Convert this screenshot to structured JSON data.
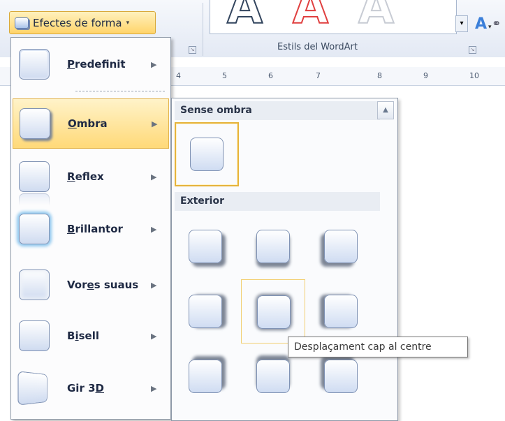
{
  "ribbon": {
    "wordart_group_label": "Estils del WordArt",
    "wordart_letter": "A",
    "text_fill_letter": "A"
  },
  "ruler": {
    "labels": [
      "4",
      "5",
      "6",
      "7",
      "8",
      "9",
      "10"
    ]
  },
  "shape_effects_button": {
    "label": "Efectes de forma"
  },
  "menu": {
    "items": [
      {
        "label": "Predefinit",
        "key": "P",
        "icon": "preset-effect-icon"
      },
      {
        "label": "Ombra",
        "key": "O",
        "icon": "shadow-effect-icon",
        "active": true
      },
      {
        "label": "Reflex",
        "key": "R",
        "icon": "reflection-effect-icon"
      },
      {
        "label": "Brillantor",
        "key": "B",
        "icon": "glow-effect-icon"
      },
      {
        "label": "Vores suaus",
        "key": "e",
        "icon": "soft-edges-effect-icon"
      },
      {
        "label": "Bisell",
        "key": "i",
        "icon": "bevel-effect-icon"
      },
      {
        "label": "Gir 3D",
        "key": "D",
        "icon": "3d-rotation-effect-icon"
      }
    ]
  },
  "submenu": {
    "section_no_shadow": "Sense ombra",
    "section_outer": "Exterior",
    "tooltip": "Desplaçament cap al centre",
    "selected_option": "Sense ombra",
    "hovered_option": "Desplaçament cap al centre"
  },
  "colors": {
    "highlight": "#ffd978",
    "highlight_border": "#e3b44c",
    "wordart_red": "#e04040",
    "text_fill_blue": "#3b7fd9"
  }
}
